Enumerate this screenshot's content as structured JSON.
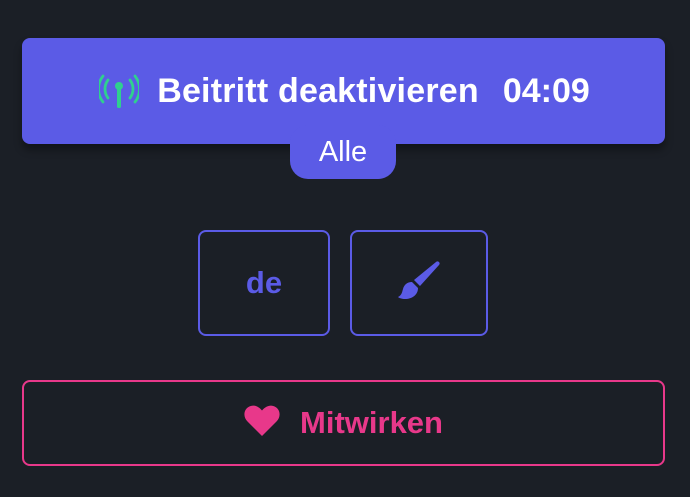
{
  "join": {
    "label": "Beitritt deaktivieren",
    "timer": "04:09",
    "icon": "antenna-icon",
    "icon_color": "#2fd08f",
    "bg_color": "#5b5be6"
  },
  "scope": {
    "label": "Alle"
  },
  "language": {
    "label": "de"
  },
  "theme": {
    "icon": "paintbrush-icon"
  },
  "contribute": {
    "label": "Mitwirken",
    "icon": "heart-icon",
    "color": "#e8388a"
  },
  "colors": {
    "background": "#1b1f26",
    "accent": "#5b5be6",
    "pink": "#e8388a",
    "green": "#2fd08f"
  }
}
